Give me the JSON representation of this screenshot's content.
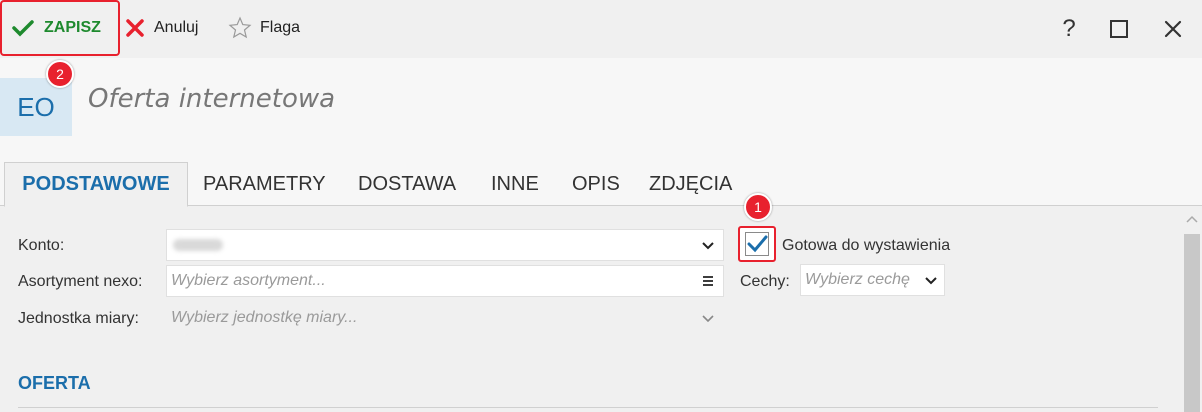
{
  "toolbar": {
    "save_label": "ZAPISZ",
    "cancel_label": "Anuluj",
    "flag_label": "Flaga",
    "help_label": "?"
  },
  "badges": {
    "save_step": "2",
    "ready_step": "1"
  },
  "header": {
    "code": "EO",
    "title": "Oferta internetowa"
  },
  "tabs": [
    {
      "label": "PODSTAWOWE",
      "active": true
    },
    {
      "label": "PARAMETRY"
    },
    {
      "label": "DOSTAWA"
    },
    {
      "label": "INNE"
    },
    {
      "label": "OPIS"
    },
    {
      "label": "ZDJĘCIA"
    }
  ],
  "form": {
    "konto_label": "Konto:",
    "asortyment_label": "Asortyment nexo:",
    "asortyment_placeholder": "Wybierz asortyment...",
    "jednostka_label": "Jednostka miary:",
    "jednostka_placeholder": "Wybierz jednostkę miary...",
    "ready_label": "Gotowa do wystawienia",
    "ready_checked": true,
    "cechy_label": "Cechy:",
    "cechy_placeholder": "Wybierz cechę"
  },
  "section": {
    "title": "OFERTA"
  },
  "colors": {
    "accent": "#1b6eab",
    "save_green": "#1e8a2e",
    "highlight_red": "#e8212e"
  }
}
